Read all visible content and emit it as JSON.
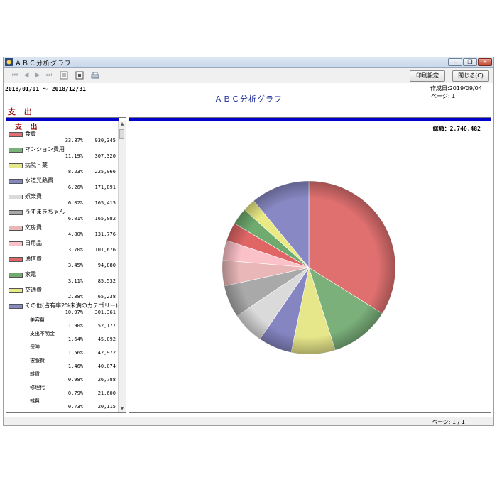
{
  "window": {
    "title": "ＡＢＣ分析グラフ",
    "minimize_label": "‒",
    "restore_label": "❐",
    "close_label": "✕"
  },
  "toolbar": {
    "print_settings_label": "印刷設定",
    "close_label": "閉じる(C)"
  },
  "report": {
    "date_range": "2018/01/01 ～ 2018/12/31",
    "title": "ＡＢＣ分析グラフ",
    "created": "作成日:2019/09/04",
    "page": "ページ: 1",
    "section": "支 出",
    "total": "総額：2,746,482"
  },
  "list": {
    "header": "支 出",
    "items": [
      {
        "name": "食費",
        "pct": "33.87%",
        "value": "930,345",
        "color": "#e07070"
      },
      {
        "name": "マンション費用",
        "pct": "11.19%",
        "value": "307,320",
        "color": "#7bb07b"
      },
      {
        "name": "病院・薬",
        "pct": "8.23%",
        "value": "225,966",
        "color": "#e6e68a"
      },
      {
        "name": "水道光熱費",
        "pct": "6.26%",
        "value": "171,891",
        "color": "#8585c2"
      },
      {
        "name": "娯楽費",
        "pct": "6.02%",
        "value": "165,415",
        "color": "#dadada"
      },
      {
        "name": "うずまきちゃん",
        "pct": "6.01%",
        "value": "165,082",
        "color": "#a9a9a9"
      },
      {
        "name": "文房費",
        "pct": "4.80%",
        "value": "131,776",
        "color": "#e9b7b7"
      },
      {
        "name": "日用品",
        "pct": "3.70%",
        "value": "101,676",
        "color": "#fbc1c8"
      },
      {
        "name": "通信費",
        "pct": "3.45%",
        "value": "94,880",
        "color": "#e06666"
      },
      {
        "name": "家電",
        "pct": "3.11%",
        "value": "85,532",
        "color": "#6fab6f"
      },
      {
        "name": "交通費",
        "pct": "2.38%",
        "value": "65,238",
        "color": "#eaea85"
      },
      {
        "name": "その他(占有率2%未満のカテゴリー)",
        "pct": "10.97%",
        "value": "301,361",
        "color": "#8888c4"
      }
    ],
    "sub_items": [
      {
        "name": "美容費",
        "pct": "1.90%",
        "value": "52,177"
      },
      {
        "name": "支出不明金",
        "pct": "1.64%",
        "value": "45,092"
      },
      {
        "name": "保険",
        "pct": "1.56%",
        "value": "42,972"
      },
      {
        "name": "被服費",
        "pct": "1.46%",
        "value": "40,074"
      },
      {
        "name": "雑貨",
        "pct": "0.98%",
        "value": "26,788"
      },
      {
        "name": "修理代",
        "pct": "0.79%",
        "value": "21,600"
      },
      {
        "name": "雑費",
        "pct": "0.73%",
        "value": "20,115"
      },
      {
        "name": "ネコ関連",
        "pct": "",
        "value": ""
      }
    ]
  },
  "chart_data": {
    "type": "pie",
    "labels": [
      "食費",
      "マンション費用",
      "病院・薬",
      "水道光熱費",
      "娯楽費",
      "うずまきちゃん",
      "文房費",
      "日用品",
      "通信費",
      "家電",
      "交通費",
      "その他(占有率2%未満のカテゴリー)"
    ],
    "values": [
      930345,
      307320,
      225966,
      171891,
      165415,
      165082,
      131776,
      101676,
      94880,
      85532,
      65238,
      301361
    ],
    "percent": [
      33.87,
      11.19,
      8.23,
      6.26,
      6.02,
      6.01,
      4.8,
      3.7,
      3.45,
      3.11,
      2.38,
      10.97
    ],
    "colors": [
      "#e07070",
      "#7bb07b",
      "#e6e68a",
      "#8585c2",
      "#dadada",
      "#a9a9a9",
      "#e9b7b7",
      "#fbc1c8",
      "#e06666",
      "#6fab6f",
      "#eaea85",
      "#8888c4"
    ],
    "start_angle": "top",
    "direction": "clockwise"
  },
  "status": {
    "pager": "ページ: 1 / 1"
  }
}
